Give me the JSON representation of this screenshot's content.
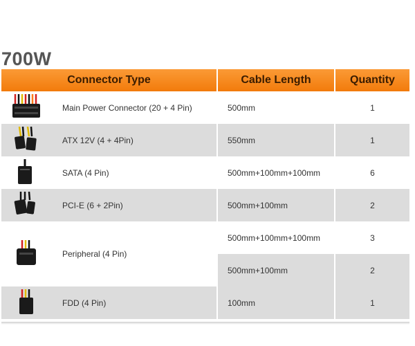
{
  "title": "700W",
  "headers": {
    "connector": "Connector Type",
    "length": "Cable Length",
    "quantity": "Quantity"
  },
  "rows": [
    {
      "connector": "Main Power Connector (20 + 4 Pin)",
      "length": "500mm",
      "quantity": "1",
      "icon": "atx-24pin-connector-icon"
    },
    {
      "connector": "ATX 12V (4 + 4Pin)",
      "length": "550mm",
      "quantity": "1",
      "icon": "atx-12v-connector-icon"
    },
    {
      "connector": "SATA (4 Pin)",
      "length": "500mm+100mm+100mm",
      "quantity": "6",
      "icon": "sata-connector-icon"
    },
    {
      "connector": "PCI-E (6 + 2Pin)",
      "length": "500mm+100mm",
      "quantity": "2",
      "icon": "pcie-connector-icon"
    },
    {
      "connector": "Peripheral (4 Pin)",
      "length": "500mm+100mm+100mm",
      "quantity": "3",
      "icon": "peripheral-connector-icon",
      "length_2": "500mm+100mm",
      "quantity_2": "2"
    },
    {
      "connector": "FDD (4 Pin)",
      "length": "100mm",
      "quantity": "1",
      "icon": "fdd-connector-icon"
    }
  ],
  "colors": {
    "header": "#f58a1f",
    "row_alt": "#dcdcdc",
    "title": "#555555"
  }
}
